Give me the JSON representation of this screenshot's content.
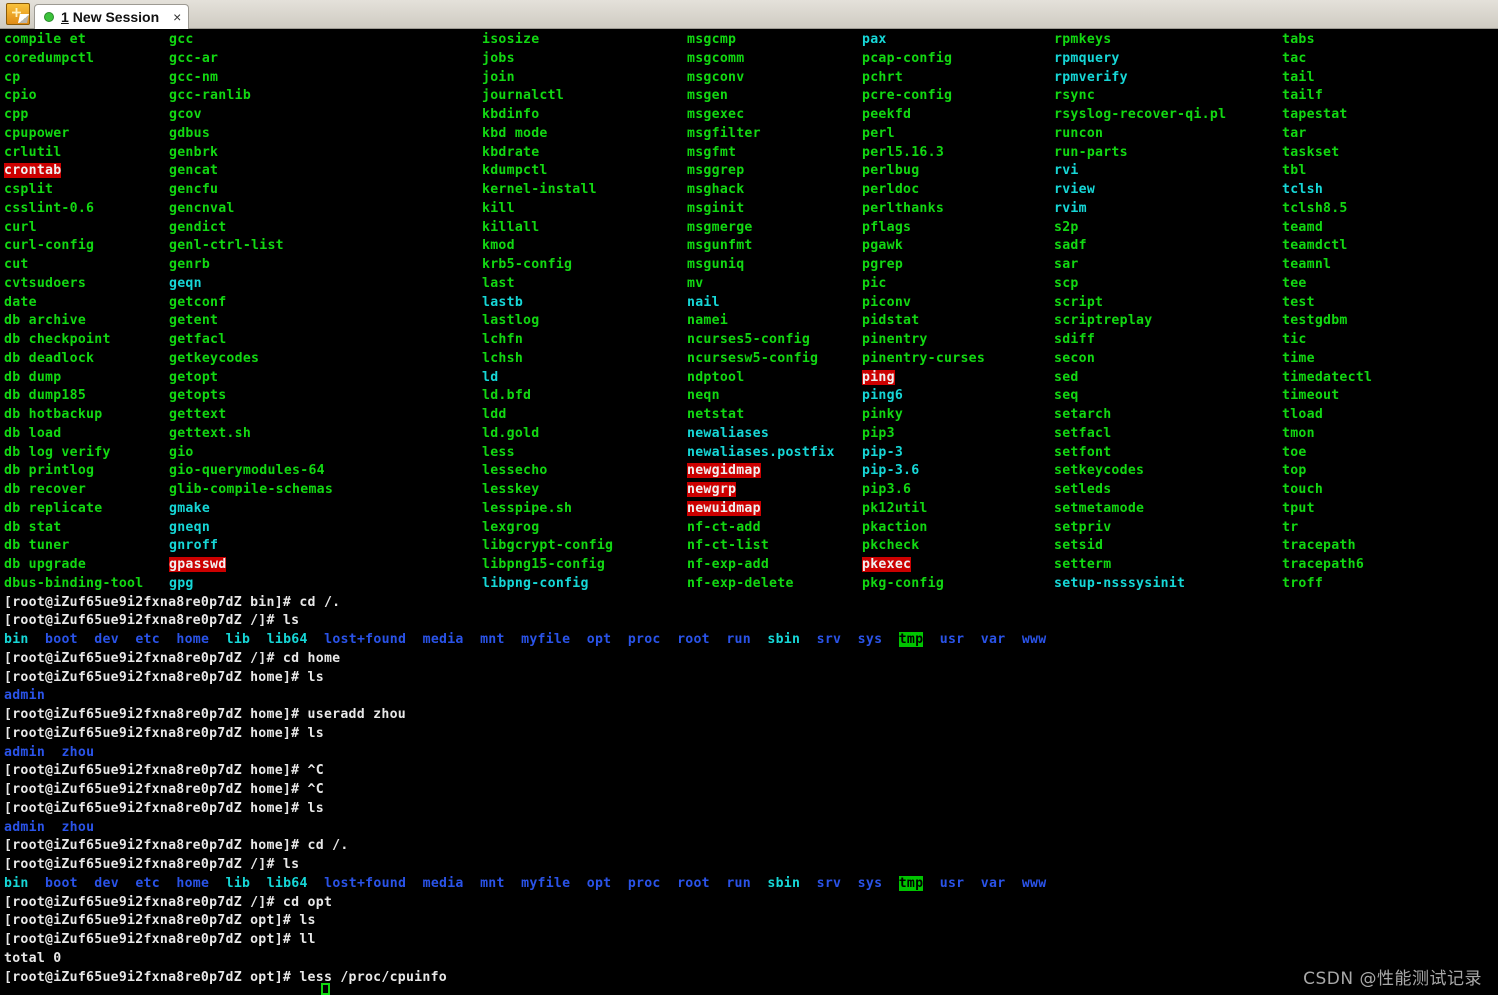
{
  "window": {
    "app_icon": "terminal-plus-icon",
    "tab": {
      "number": "1",
      "title": "New Session",
      "close_label": "×",
      "status_dot": "connected"
    }
  },
  "terminal": {
    "prompt_user": "root",
    "prompt_host": "iZuf65ue9i2fxna8re0p7dZ",
    "colors": {
      "background": "#000000",
      "executable": "#12d812",
      "symlink": "#16d7d7",
      "directory": "#2a53e8",
      "normal": "#e8e8e8",
      "setuid_bg": "#cc0000",
      "sticky_bg": "#00c400"
    },
    "ls_bin_columns": [
      [
        {
          "t": "compile et",
          "c": "g"
        },
        {
          "t": "coredumpctl",
          "c": "g"
        },
        {
          "t": "cp",
          "c": "g"
        },
        {
          "t": "cpio",
          "c": "g"
        },
        {
          "t": "cpp",
          "c": "g"
        },
        {
          "t": "cpupower",
          "c": "g"
        },
        {
          "t": "crlutil",
          "c": "g"
        },
        {
          "t": "crontab",
          "c": "setuid"
        },
        {
          "t": "csplit",
          "c": "g"
        },
        {
          "t": "csslint-0.6",
          "c": "g"
        },
        {
          "t": "curl",
          "c": "g"
        },
        {
          "t": "curl-config",
          "c": "g"
        },
        {
          "t": "cut",
          "c": "g"
        },
        {
          "t": "cvtsudoers",
          "c": "g"
        },
        {
          "t": "date",
          "c": "g"
        },
        {
          "t": "db archive",
          "c": "g"
        },
        {
          "t": "db checkpoint",
          "c": "g"
        },
        {
          "t": "db deadlock",
          "c": "g"
        },
        {
          "t": "db dump",
          "c": "g"
        },
        {
          "t": "db dump185",
          "c": "g"
        },
        {
          "t": "db hotbackup",
          "c": "g"
        },
        {
          "t": "db load",
          "c": "g"
        },
        {
          "t": "db log verify",
          "c": "g"
        },
        {
          "t": "db printlog",
          "c": "g"
        },
        {
          "t": "db recover",
          "c": "g"
        },
        {
          "t": "db replicate",
          "c": "g"
        },
        {
          "t": "db stat",
          "c": "g"
        },
        {
          "t": "db tuner",
          "c": "g"
        },
        {
          "t": "db upgrade",
          "c": "g"
        },
        {
          "t": "dbus-binding-tool",
          "c": "g"
        }
      ],
      [
        {
          "t": "gcc",
          "c": "g"
        },
        {
          "t": "gcc-ar",
          "c": "g"
        },
        {
          "t": "gcc-nm",
          "c": "g"
        },
        {
          "t": "gcc-ranlib",
          "c": "g"
        },
        {
          "t": "gcov",
          "c": "g"
        },
        {
          "t": "gdbus",
          "c": "g"
        },
        {
          "t": "genbrk",
          "c": "g"
        },
        {
          "t": "gencat",
          "c": "g"
        },
        {
          "t": "gencfu",
          "c": "g"
        },
        {
          "t": "gencnval",
          "c": "g"
        },
        {
          "t": "gendict",
          "c": "g"
        },
        {
          "t": "genl-ctrl-list",
          "c": "g"
        },
        {
          "t": "genrb",
          "c": "g"
        },
        {
          "t": "geqn",
          "c": "c"
        },
        {
          "t": "getconf",
          "c": "g"
        },
        {
          "t": "getent",
          "c": "g"
        },
        {
          "t": "getfacl",
          "c": "g"
        },
        {
          "t": "getkeycodes",
          "c": "g"
        },
        {
          "t": "getopt",
          "c": "g"
        },
        {
          "t": "getopts",
          "c": "g"
        },
        {
          "t": "gettext",
          "c": "g"
        },
        {
          "t": "gettext.sh",
          "c": "g"
        },
        {
          "t": "gio",
          "c": "g"
        },
        {
          "t": "gio-querymodules-64",
          "c": "g"
        },
        {
          "t": "glib-compile-schemas",
          "c": "g"
        },
        {
          "t": "gmake",
          "c": "c"
        },
        {
          "t": "gneqn",
          "c": "c"
        },
        {
          "t": "gnroff",
          "c": "c"
        },
        {
          "t": "gpasswd",
          "c": "setuid"
        },
        {
          "t": "gpg",
          "c": "c"
        }
      ],
      [
        {
          "t": "isosize",
          "c": "g"
        },
        {
          "t": "jobs",
          "c": "g"
        },
        {
          "t": "join",
          "c": "g"
        },
        {
          "t": "journalctl",
          "c": "g"
        },
        {
          "t": "kbdinfo",
          "c": "g"
        },
        {
          "t": "kbd mode",
          "c": "g"
        },
        {
          "t": "kbdrate",
          "c": "g"
        },
        {
          "t": "kdumpctl",
          "c": "g"
        },
        {
          "t": "kernel-install",
          "c": "g"
        },
        {
          "t": "kill",
          "c": "g"
        },
        {
          "t": "killall",
          "c": "g"
        },
        {
          "t": "kmod",
          "c": "g"
        },
        {
          "t": "krb5-config",
          "c": "g"
        },
        {
          "t": "last",
          "c": "g"
        },
        {
          "t": "lastb",
          "c": "c"
        },
        {
          "t": "lastlog",
          "c": "g"
        },
        {
          "t": "lchfn",
          "c": "g"
        },
        {
          "t": "lchsh",
          "c": "g"
        },
        {
          "t": "ld",
          "c": "c"
        },
        {
          "t": "ld.bfd",
          "c": "g"
        },
        {
          "t": "ldd",
          "c": "g"
        },
        {
          "t": "ld.gold",
          "c": "g"
        },
        {
          "t": "less",
          "c": "g"
        },
        {
          "t": "lessecho",
          "c": "g"
        },
        {
          "t": "lesskey",
          "c": "g"
        },
        {
          "t": "lesspipe.sh",
          "c": "g"
        },
        {
          "t": "lexgrog",
          "c": "g"
        },
        {
          "t": "libgcrypt-config",
          "c": "g"
        },
        {
          "t": "libpng15-config",
          "c": "g"
        },
        {
          "t": "libpng-config",
          "c": "c"
        }
      ],
      [
        {
          "t": "msgcmp",
          "c": "g"
        },
        {
          "t": "msgcomm",
          "c": "g"
        },
        {
          "t": "msgconv",
          "c": "g"
        },
        {
          "t": "msgen",
          "c": "g"
        },
        {
          "t": "msgexec",
          "c": "g"
        },
        {
          "t": "msgfilter",
          "c": "g"
        },
        {
          "t": "msgfmt",
          "c": "g"
        },
        {
          "t": "msggrep",
          "c": "g"
        },
        {
          "t": "msghack",
          "c": "g"
        },
        {
          "t": "msginit",
          "c": "g"
        },
        {
          "t": "msgmerge",
          "c": "g"
        },
        {
          "t": "msgunfmt",
          "c": "g"
        },
        {
          "t": "msguniq",
          "c": "g"
        },
        {
          "t": "mv",
          "c": "g"
        },
        {
          "t": "nail",
          "c": "c"
        },
        {
          "t": "namei",
          "c": "g"
        },
        {
          "t": "ncurses5-config",
          "c": "g"
        },
        {
          "t": "ncursesw5-config",
          "c": "g"
        },
        {
          "t": "ndptool",
          "c": "g"
        },
        {
          "t": "neqn",
          "c": "g"
        },
        {
          "t": "netstat",
          "c": "g"
        },
        {
          "t": "newaliases",
          "c": "c"
        },
        {
          "t": "newaliases.postfix",
          "c": "c"
        },
        {
          "t": "newgidmap",
          "c": "setuid"
        },
        {
          "t": "newgrp",
          "c": "setuid"
        },
        {
          "t": "newuidmap",
          "c": "setuid"
        },
        {
          "t": "nf-ct-add",
          "c": "g"
        },
        {
          "t": "nf-ct-list",
          "c": "g"
        },
        {
          "t": "nf-exp-add",
          "c": "g"
        },
        {
          "t": "nf-exp-delete",
          "c": "g"
        }
      ],
      [
        {
          "t": "pax",
          "c": "c"
        },
        {
          "t": "pcap-config",
          "c": "g"
        },
        {
          "t": "pchrt",
          "c": "g"
        },
        {
          "t": "pcre-config",
          "c": "g"
        },
        {
          "t": "peekfd",
          "c": "g"
        },
        {
          "t": "perl",
          "c": "g"
        },
        {
          "t": "perl5.16.3",
          "c": "g"
        },
        {
          "t": "perlbug",
          "c": "g"
        },
        {
          "t": "perldoc",
          "c": "g"
        },
        {
          "t": "perlthanks",
          "c": "g"
        },
        {
          "t": "pflags",
          "c": "g"
        },
        {
          "t": "pgawk",
          "c": "g"
        },
        {
          "t": "pgrep",
          "c": "g"
        },
        {
          "t": "pic",
          "c": "g"
        },
        {
          "t": "piconv",
          "c": "g"
        },
        {
          "t": "pidstat",
          "c": "g"
        },
        {
          "t": "pinentry",
          "c": "g"
        },
        {
          "t": "pinentry-curses",
          "c": "g"
        },
        {
          "t": "ping",
          "c": "setuid"
        },
        {
          "t": "ping6",
          "c": "c"
        },
        {
          "t": "pinky",
          "c": "g"
        },
        {
          "t": "pip3",
          "c": "g"
        },
        {
          "t": "pip-3",
          "c": "c"
        },
        {
          "t": "pip-3.6",
          "c": "c"
        },
        {
          "t": "pip3.6",
          "c": "g"
        },
        {
          "t": "pk12util",
          "c": "g"
        },
        {
          "t": "pkaction",
          "c": "g"
        },
        {
          "t": "pkcheck",
          "c": "g"
        },
        {
          "t": "pkexec",
          "c": "setuid"
        },
        {
          "t": "pkg-config",
          "c": "g"
        }
      ],
      [
        {
          "t": "rpmkeys",
          "c": "g"
        },
        {
          "t": "rpmquery",
          "c": "c"
        },
        {
          "t": "rpmverify",
          "c": "c"
        },
        {
          "t": "rsync",
          "c": "g"
        },
        {
          "t": "rsyslog-recover-qi.pl",
          "c": "g"
        },
        {
          "t": "runcon",
          "c": "g"
        },
        {
          "t": "run-parts",
          "c": "g"
        },
        {
          "t": "rvi",
          "c": "c"
        },
        {
          "t": "rview",
          "c": "c"
        },
        {
          "t": "rvim",
          "c": "c"
        },
        {
          "t": "s2p",
          "c": "g"
        },
        {
          "t": "sadf",
          "c": "g"
        },
        {
          "t": "sar",
          "c": "g"
        },
        {
          "t": "scp",
          "c": "g"
        },
        {
          "t": "script",
          "c": "g"
        },
        {
          "t": "scriptreplay",
          "c": "g"
        },
        {
          "t": "sdiff",
          "c": "g"
        },
        {
          "t": "secon",
          "c": "g"
        },
        {
          "t": "sed",
          "c": "g"
        },
        {
          "t": "seq",
          "c": "g"
        },
        {
          "t": "setarch",
          "c": "g"
        },
        {
          "t": "setfacl",
          "c": "g"
        },
        {
          "t": "setfont",
          "c": "g"
        },
        {
          "t": "setkeycodes",
          "c": "g"
        },
        {
          "t": "setleds",
          "c": "g"
        },
        {
          "t": "setmetamode",
          "c": "g"
        },
        {
          "t": "setpriv",
          "c": "g"
        },
        {
          "t": "setsid",
          "c": "g"
        },
        {
          "t": "setterm",
          "c": "g"
        },
        {
          "t": "setup-nsssysinit",
          "c": "c"
        }
      ],
      [
        {
          "t": "tabs",
          "c": "g"
        },
        {
          "t": "tac",
          "c": "g"
        },
        {
          "t": "tail",
          "c": "g"
        },
        {
          "t": "tailf",
          "c": "g"
        },
        {
          "t": "tapestat",
          "c": "g"
        },
        {
          "t": "tar",
          "c": "g"
        },
        {
          "t": "taskset",
          "c": "g"
        },
        {
          "t": "tbl",
          "c": "g"
        },
        {
          "t": "tclsh",
          "c": "c"
        },
        {
          "t": "tclsh8.5",
          "c": "g"
        },
        {
          "t": "teamd",
          "c": "g"
        },
        {
          "t": "teamdctl",
          "c": "g"
        },
        {
          "t": "teamnl",
          "c": "g"
        },
        {
          "t": "tee",
          "c": "g"
        },
        {
          "t": "test",
          "c": "g"
        },
        {
          "t": "testgdbm",
          "c": "g"
        },
        {
          "t": "tic",
          "c": "g"
        },
        {
          "t": "time",
          "c": "g"
        },
        {
          "t": "timedatectl",
          "c": "g"
        },
        {
          "t": "timeout",
          "c": "g"
        },
        {
          "t": "tload",
          "c": "g"
        },
        {
          "t": "tmon",
          "c": "g"
        },
        {
          "t": "toe",
          "c": "g"
        },
        {
          "t": "top",
          "c": "g"
        },
        {
          "t": "touch",
          "c": "g"
        },
        {
          "t": "tput",
          "c": "g"
        },
        {
          "t": "tr",
          "c": "g"
        },
        {
          "t": "tracepath",
          "c": "g"
        },
        {
          "t": "tracepath6",
          "c": "g"
        },
        {
          "t": "troff",
          "c": "g"
        }
      ]
    ],
    "root_listing": [
      {
        "t": "bin",
        "c": "c"
      },
      {
        "t": "boot",
        "c": "b"
      },
      {
        "t": "dev",
        "c": "b"
      },
      {
        "t": "etc",
        "c": "b"
      },
      {
        "t": "home",
        "c": "b"
      },
      {
        "t": "lib",
        "c": "c"
      },
      {
        "t": "lib64",
        "c": "c"
      },
      {
        "t": "lost+found",
        "c": "b"
      },
      {
        "t": "media",
        "c": "b"
      },
      {
        "t": "mnt",
        "c": "b"
      },
      {
        "t": "myfile",
        "c": "b"
      },
      {
        "t": "opt",
        "c": "b"
      },
      {
        "t": "proc",
        "c": "b"
      },
      {
        "t": "root",
        "c": "b"
      },
      {
        "t": "run",
        "c": "b"
      },
      {
        "t": "sbin",
        "c": "c"
      },
      {
        "t": "srv",
        "c": "b"
      },
      {
        "t": "sys",
        "c": "b"
      },
      {
        "t": "tmp",
        "c": "sticky"
      },
      {
        "t": "usr",
        "c": "b"
      },
      {
        "t": "var",
        "c": "b"
      },
      {
        "t": "www",
        "c": "b"
      }
    ],
    "session_lines": [
      {
        "type": "prompt",
        "cwd": "bin",
        "cmd": "cd /."
      },
      {
        "type": "prompt",
        "cwd": "/",
        "cmd": "ls"
      },
      {
        "type": "root_listing"
      },
      {
        "type": "prompt",
        "cwd": "/",
        "cmd": "cd home"
      },
      {
        "type": "prompt",
        "cwd": "home",
        "cmd": "ls"
      },
      {
        "type": "dirs",
        "items": [
          {
            "t": "admin",
            "c": "b"
          }
        ]
      },
      {
        "type": "prompt",
        "cwd": "home",
        "cmd": "useradd zhou"
      },
      {
        "type": "prompt",
        "cwd": "home",
        "cmd": "ls"
      },
      {
        "type": "dirs",
        "items": [
          {
            "t": "admin",
            "c": "b"
          },
          {
            "t": "zhou",
            "c": "b"
          }
        ]
      },
      {
        "type": "prompt",
        "cwd": "home",
        "cmd": "^C"
      },
      {
        "type": "prompt",
        "cwd": "home",
        "cmd": "^C"
      },
      {
        "type": "prompt",
        "cwd": "home",
        "cmd": "ls"
      },
      {
        "type": "dirs",
        "items": [
          {
            "t": "admin",
            "c": "b"
          },
          {
            "t": "zhou",
            "c": "b"
          }
        ]
      },
      {
        "type": "prompt",
        "cwd": "home",
        "cmd": "cd /."
      },
      {
        "type": "prompt",
        "cwd": "/",
        "cmd": "ls"
      },
      {
        "type": "root_listing"
      },
      {
        "type": "prompt",
        "cwd": "/",
        "cmd": "cd opt"
      },
      {
        "type": "prompt",
        "cwd": "opt",
        "cmd": "ls"
      },
      {
        "type": "prompt",
        "cwd": "opt",
        "cmd": "ll"
      },
      {
        "type": "plain",
        "text": "total 0"
      },
      {
        "type": "prompt",
        "cwd": "opt",
        "cmd": "less /proc/cpuinfo"
      }
    ]
  },
  "watermark": "CSDN @性能测试记录"
}
